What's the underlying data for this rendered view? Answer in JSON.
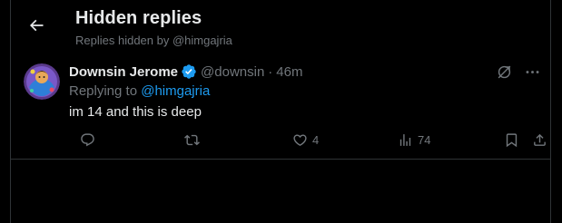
{
  "header": {
    "title": "Hidden replies",
    "subtitle": "Replies hidden by @himgajria"
  },
  "tweet": {
    "display_name": "Downsin Jerome",
    "handle": "@downsin",
    "separator": "·",
    "time": "46m",
    "replying_prefix": "Replying to ",
    "replying_to": "@himgajria",
    "text": "im 14 and this is deep",
    "likes": "4",
    "views": "74"
  },
  "icons": {
    "back": "arrow-left-icon",
    "verified": "verified-badge-icon",
    "unhide": "unhide-icon",
    "more": "more-icon",
    "reply": "reply-icon",
    "repost": "repost-icon",
    "like": "heart-icon",
    "views": "analytics-icon",
    "bookmark": "bookmark-icon",
    "share": "share-icon"
  },
  "colors": {
    "background": "#000000",
    "text_primary": "#e7e9ea",
    "text_secondary": "#71767b",
    "accent": "#1d9bf0",
    "border": "#2f3336"
  }
}
